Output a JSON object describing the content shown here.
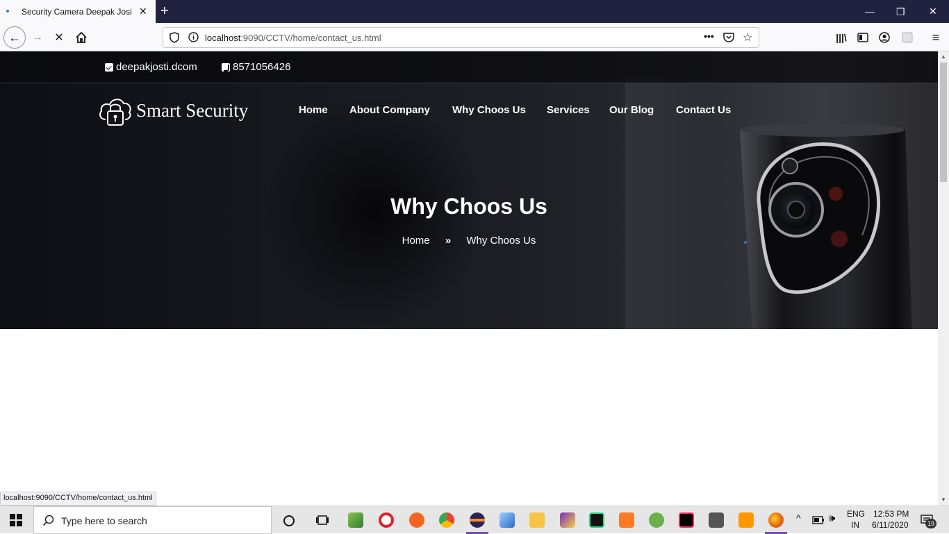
{
  "browser": {
    "tab_title": "Security Camera Deepak Josi",
    "url_host": "localhost",
    "url_rest": ":9090/CCTV/home/contact_us.html",
    "status_url": "localhost:9090/CCTV/home/contact_us.html"
  },
  "site": {
    "email": "deepakjosti.dcom",
    "phone": "8571056426",
    "logo_text": "Smart Security",
    "menu": [
      "Home",
      "About Company",
      "Why Choos Us",
      "Services",
      "Our Blog",
      "Contact Us"
    ],
    "page_title": "Why Choos Us",
    "breadcrumb": {
      "home": "Home",
      "separator": "»",
      "current": "Why Choos Us"
    }
  },
  "taskbar": {
    "search_placeholder": "Type here to search",
    "language_line1": "ENG",
    "language_line2": "IN",
    "time": "12:53 PM",
    "date": "6/11/2020",
    "notification_count": "19"
  }
}
